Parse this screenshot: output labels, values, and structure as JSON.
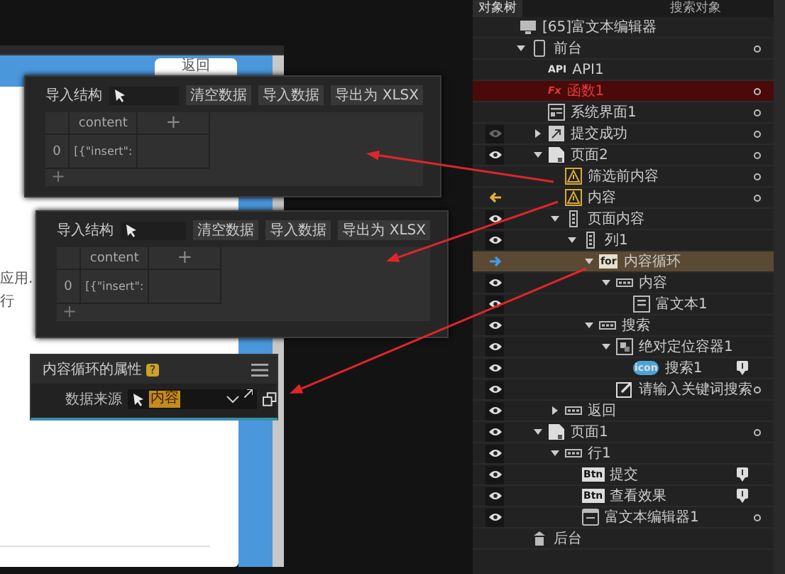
{
  "canvas": {
    "top_button": "返回",
    "texts": [
      "应用.",
      "行"
    ]
  },
  "panels": [
    {
      "title": "导入结构",
      "buttons": [
        "清空数据",
        "导入数据",
        "导出为 XLSX"
      ],
      "table": {
        "header": "content",
        "add": "+",
        "rows": [
          {
            "index": "0",
            "content": "[{\"insert\":"
          }
        ]
      }
    },
    {
      "title": "导入结构",
      "buttons": [
        "清空数据",
        "导入数据",
        "导出为 XLSX"
      ],
      "table": {
        "header": "content",
        "add": "+",
        "rows": [
          {
            "index": "0",
            "content": "[{\"insert\":"
          }
        ]
      }
    }
  ],
  "property_panel": {
    "title": "内容循环的属性",
    "help": "?",
    "field_label": "数据来源",
    "value": "内容"
  },
  "object_tree": {
    "tabs": [
      {
        "label": "对象树",
        "selected": true
      },
      {
        "label": "搜索对象",
        "selected": false
      }
    ],
    "root": {
      "label": "[65]富文本编辑器"
    },
    "items": [
      {
        "label": "前台",
        "kind": "phone",
        "expanded": true,
        "dot": true,
        "selected": false,
        "children": [
          {
            "label": "API1",
            "kind": "api",
            "icon_text": "API",
            "dot": false,
            "selected": false
          },
          {
            "label": "函数1",
            "kind": "function",
            "icon_text": "Fx",
            "error": true,
            "dot": true,
            "selected": false
          },
          {
            "label": "系统界面1",
            "kind": "screen",
            "dot": true,
            "selected": false
          },
          {
            "label": "提交成功",
            "kind": "popup",
            "expanded": false,
            "visible": false,
            "dot": true,
            "selected": false
          },
          {
            "label": "页面2",
            "kind": "page",
            "expanded": true,
            "visible": true,
            "dot": true,
            "selected": false,
            "children": [
              {
                "label": "筛选前内容",
                "kind": "warning",
                "dot": true,
                "selected": false
              },
              {
                "label": "内容",
                "kind": "warning",
                "source_marker": true,
                "dot": true,
                "selected": false
              },
              {
                "label": "页面内容",
                "kind": "column",
                "expanded": true,
                "visible": true,
                "dot": false,
                "selected": false,
                "children": [
                  {
                    "label": "列1",
                    "kind": "column",
                    "expanded": true,
                    "visible": true,
                    "dot": false,
                    "selected": false,
                    "children": [
                      {
                        "label": "内容循环",
                        "kind": "loop",
                        "icon_text": "for",
                        "expanded": true,
                        "target_marker": true,
                        "dot": false,
                        "selected": true,
                        "children": [
                          {
                            "label": "内容",
                            "kind": "row",
                            "expanded": true,
                            "visible": true,
                            "dot": false,
                            "selected": false,
                            "children": [
                              {
                                "label": "富文本1",
                                "kind": "richtext",
                                "visible": true,
                                "dot": false,
                                "selected": false
                              }
                            ]
                          }
                        ]
                      },
                      {
                        "label": "搜索",
                        "kind": "row",
                        "expanded": true,
                        "visible": true,
                        "dot": false,
                        "selected": false,
                        "children": [
                          {
                            "label": "绝对定位容器1",
                            "kind": "absolute",
                            "expanded": true,
                            "visible": true,
                            "dot": false,
                            "selected": false,
                            "children": [
                              {
                                "label": "搜索1",
                                "kind": "iconbadge",
                                "icon_text": "icon",
                                "visible": true,
                                "badge": true,
                                "dot": false,
                                "selected": false
                              }
                            ]
                          },
                          {
                            "label": "请输入关键词搜索",
                            "kind": "input",
                            "visible": true,
                            "dot": true,
                            "selected": false
                          }
                        ]
                      }
                    ]
                  }
                ]
              },
              {
                "label": "返回",
                "kind": "row",
                "expanded": false,
                "visible": true,
                "dot": false,
                "selected": false
              }
            ]
          },
          {
            "label": "页面1",
            "kind": "page",
            "expanded": true,
            "visible": true,
            "dot": true,
            "selected": false,
            "children": [
              {
                "label": "行1",
                "kind": "row",
                "expanded": true,
                "visible": true,
                "dot": false,
                "selected": false,
                "children": [
                  {
                    "label": "提交",
                    "kind": "button",
                    "icon_text": "Btn",
                    "visible": true,
                    "badge": true,
                    "dot": false,
                    "selected": false
                  },
                  {
                    "label": "查看效果",
                    "kind": "button",
                    "icon_text": "Btn",
                    "visible": true,
                    "badge": true,
                    "dot": false,
                    "selected": false
                  },
                  {
                    "label": "富文本编辑器1",
                    "kind": "editor",
                    "visible": true,
                    "dot": true,
                    "selected": false
                  }
                ]
              }
            ]
          }
        ]
      },
      {
        "label": "后台",
        "kind": "server",
        "dot": false,
        "selected": false
      }
    ]
  }
}
